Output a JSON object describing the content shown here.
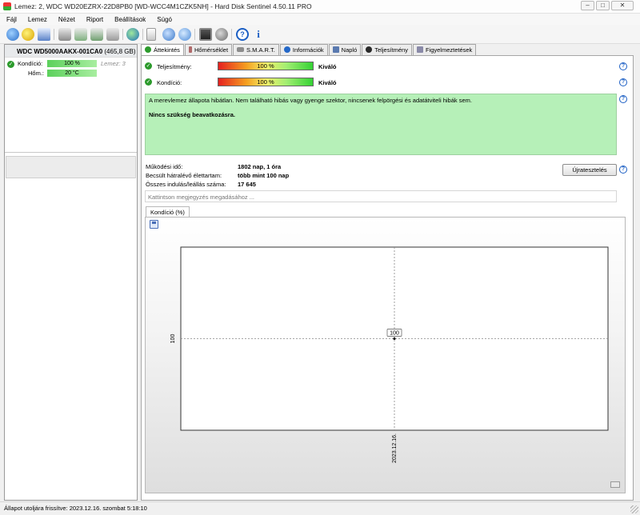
{
  "window": {
    "title": "Lemez: 2, WDC WD20EZRX-22D8PB0 [WD-WCC4M1CZK5NH]  -  Hard Disk Sentinel 4.50.11 PRO",
    "minimize": "–",
    "maximize": "□",
    "close": "✕"
  },
  "menu": [
    "Fájl",
    "Lemez",
    "Nézet",
    "Riport",
    "Beállítások",
    "Súgó"
  ],
  "toolbar_icons": [
    "refresh-icon",
    "warning-icon",
    "report-icon",
    "disk-icon",
    "disk-up-icon",
    "disk-down-icon",
    "disk-plug-icon",
    "globe-icon",
    "document-icon",
    "sync-icon",
    "network-icon",
    "monitor-icon",
    "settings-icon",
    "help-icon",
    "info-icon"
  ],
  "left_panel": {
    "disk_model": "WDC WD5000AAKX-001CA0",
    "disk_size": "(465,8 GB)",
    "kondicio_label": "Kondíció:",
    "kondicio_value": "100 %",
    "lemez_label": "Lemez: 3",
    "hom_label": "Hőm.:",
    "hom_value": "20 °C"
  },
  "tabs": [
    "Áttekintés",
    "Hőmérséklet",
    "S.M.A.R.T.",
    "Információk",
    "Napló",
    "Teljesítmény",
    "Figyelmeztetések"
  ],
  "tab_colors": [
    "#2c9a2c",
    "#b06a6a",
    "#8c8c8c",
    "#2468c8",
    "#5a7ab0",
    "#2a2a2a",
    "#8a8aa8"
  ],
  "overview": {
    "teljesitmeny_label": "Teljesítmény:",
    "teljesitmeny_value": "100 %",
    "teljesitmeny_fraction": 1.0,
    "teljesitmeny_rating": "Kiváló",
    "kondicio_label": "Kondíció:",
    "kondicio_value": "100 %",
    "kondicio_fraction": 1.0,
    "kondicio_rating": "Kiváló",
    "message_line1": "A merevlemez állapota hibátlan. Nem található hibás vagy gyenge szektor, nincsenek felpörgési és adatátviteli hibák sem.",
    "message_line2": "Nincs szükség beavatkozásra.",
    "mukodesi_ido_label": "Működési idő:",
    "mukodesi_ido_value": "1802 nap, 1 óra",
    "becsult_label": "Becsült hátralévő élettartam:",
    "becsult_value": "több mint 100 nap",
    "indulas_label": "Összes indulás/leállás száma:",
    "indulas_value": "17 645",
    "retest_button": "Újratesztelés",
    "note_placeholder": "Kattintson megjegyzés megadásához ..."
  },
  "chart_tab": "Kondíció  (%)",
  "chart_data": {
    "type": "line",
    "x": [
      "2023.12.16."
    ],
    "series": [
      {
        "values": [
          100
        ]
      }
    ],
    "xlabel": "",
    "ylabel": "",
    "y_tick_labels": [
      "100"
    ],
    "x_tick_labels": [
      "2023.12.16."
    ],
    "data_labels": [
      "100"
    ],
    "grid": true
  },
  "status": {
    "text": "Állapot utoljára frissítve: 2023.12.16. szombat 5:18:10"
  },
  "colors": {
    "good": "#2c9a2c",
    "message_bg": "#b6f0b8",
    "help": "#1c5fc4"
  }
}
